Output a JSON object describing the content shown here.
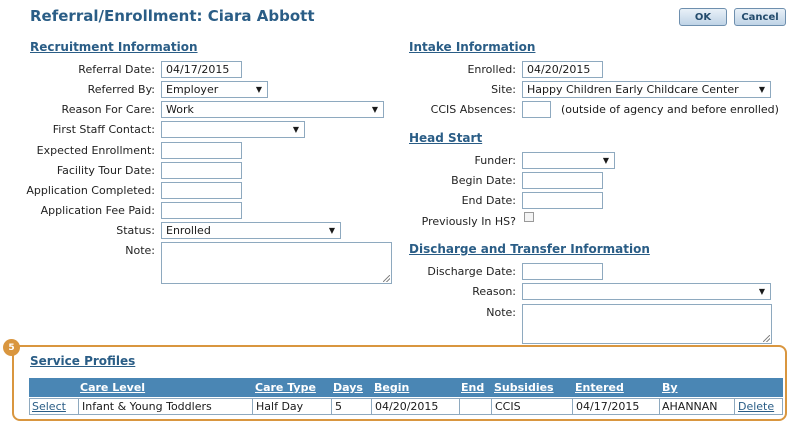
{
  "header": {
    "title": "Referral/Enrollment: Ciara Abbott",
    "ok_label": "OK",
    "cancel_label": "Cancel"
  },
  "recruitment": {
    "title": "Recruitment Information",
    "referral_date": {
      "label": "Referral Date:",
      "value": "04/17/2015"
    },
    "referred_by": {
      "label": "Referred By:",
      "value": "Employer"
    },
    "reason_for_care": {
      "label": "Reason For Care:",
      "value": "Work"
    },
    "first_staff_contact": {
      "label": "First Staff Contact:",
      "value": ""
    },
    "expected_enrollment": {
      "label": "Expected Enrollment:",
      "value": ""
    },
    "facility_tour_date": {
      "label": "Facility Tour Date:",
      "value": ""
    },
    "application_completed": {
      "label": "Application Completed:",
      "value": ""
    },
    "application_fee_paid": {
      "label": "Application Fee Paid:",
      "value": ""
    },
    "status": {
      "label": "Status:",
      "value": "Enrolled"
    },
    "note": {
      "label": "Note:",
      "value": ""
    }
  },
  "intake": {
    "title": "Intake Information",
    "enrolled": {
      "label": "Enrolled:",
      "value": "04/20/2015"
    },
    "site": {
      "label": "Site:",
      "value": "Happy Children Early Childcare Center"
    },
    "ccis_absences": {
      "label": "CCIS Absences:",
      "value": "",
      "hint": "(outside of agency and before enrolled)"
    }
  },
  "head_start": {
    "title": "Head Start",
    "funder": {
      "label": "Funder:",
      "value": ""
    },
    "begin_date": {
      "label": "Begin Date:",
      "value": ""
    },
    "end_date": {
      "label": "End Date:",
      "value": ""
    },
    "previously_in_hs": {
      "label": "Previously In HS?",
      "checked": false
    }
  },
  "discharge": {
    "title": "Discharge and Transfer Information",
    "discharge_date": {
      "label": "Discharge Date:",
      "value": ""
    },
    "reason": {
      "label": "Reason:",
      "value": ""
    },
    "note": {
      "label": "Note:",
      "value": ""
    }
  },
  "service_profiles": {
    "badge": "5",
    "title": "Service Profiles",
    "columns": [
      "Care Level",
      "Care Type",
      "Days",
      "Begin",
      "End",
      "Subsidies",
      "Entered",
      "By"
    ],
    "rows": [
      {
        "select": "Select",
        "care_level": "Infant & Young Toddlers",
        "care_type": "Half Day",
        "days": "5",
        "begin": "04/20/2015",
        "end": "",
        "subsidies": "CCIS",
        "entered": "04/17/2015",
        "by": "AHANNAN",
        "delete": "Delete"
      }
    ]
  }
}
